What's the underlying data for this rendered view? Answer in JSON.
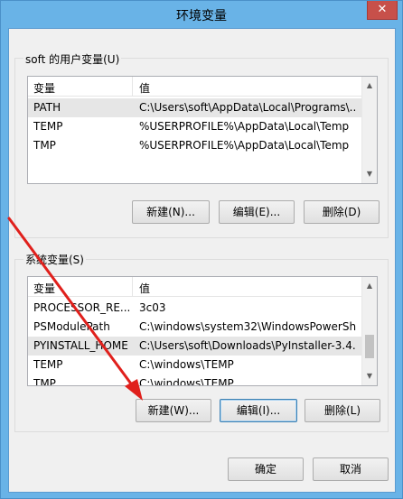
{
  "window": {
    "title": "环境变量",
    "close_glyph": "✕"
  },
  "user_vars": {
    "group_label": "soft 的用户变量(U)",
    "col_name": "变量",
    "col_value": "值",
    "rows": [
      {
        "name": "PATH",
        "value": "C:\\Users\\soft\\AppData\\Local\\Programs\\..."
      },
      {
        "name": "TEMP",
        "value": "%USERPROFILE%\\AppData\\Local\\Temp"
      },
      {
        "name": "TMP",
        "value": "%USERPROFILE%\\AppData\\Local\\Temp"
      }
    ],
    "buttons": {
      "new": "新建(N)...",
      "edit": "编辑(E)...",
      "delete": "删除(D)"
    }
  },
  "system_vars": {
    "group_label": "系统变量(S)",
    "col_name": "变量",
    "col_value": "值",
    "rows": [
      {
        "name": "PROCESSOR_RE...",
        "value": "3c03"
      },
      {
        "name": "PSModulePath",
        "value": "C:\\windows\\system32\\WindowsPowerSh..."
      },
      {
        "name": "PYINSTALL_HOME",
        "value": "C:\\Users\\soft\\Downloads\\PyInstaller-3.4..."
      },
      {
        "name": "TEMP",
        "value": "C:\\windows\\TEMP"
      },
      {
        "name": "TMP",
        "value": "C:\\windows\\TEMP"
      }
    ],
    "buttons": {
      "new": "新建(W)...",
      "edit": "编辑(I)...",
      "delete": "删除(L)"
    }
  },
  "footer": {
    "ok": "确定",
    "cancel": "取消"
  },
  "colors": {
    "annotation_arrow": "#e0201c",
    "titlebar": "#69b3e7",
    "close": "#c7504a"
  },
  "icons": {
    "close": "close-icon",
    "scroll_up": "chevron-up-icon",
    "scroll_down": "chevron-down-icon"
  }
}
